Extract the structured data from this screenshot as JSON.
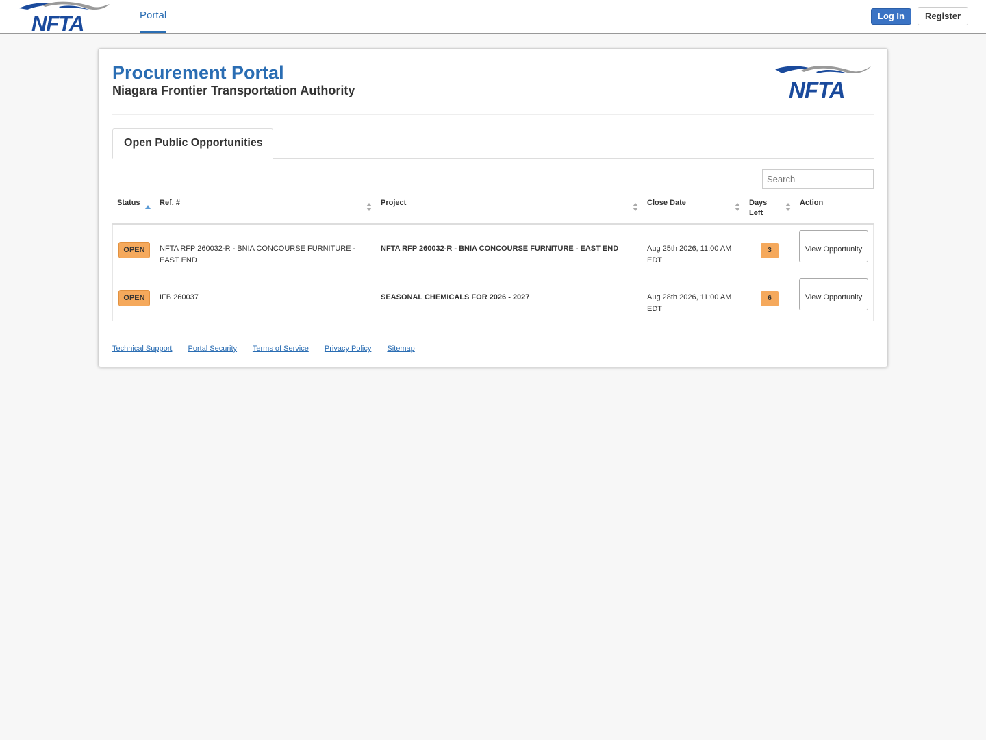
{
  "nav": {
    "portal_tab": "Portal",
    "login_label": "Log In",
    "register_label": "Register"
  },
  "logo": {
    "text": "NFTA",
    "icon": "nfta-logo"
  },
  "header": {
    "title": "Procurement Portal",
    "subtitle": "Niagara Frontier Transportation Authority"
  },
  "tabs": [
    {
      "label": "Open Public Opportunities",
      "active": true
    }
  ],
  "search": {
    "placeholder": "Search",
    "value": ""
  },
  "table": {
    "columns": [
      {
        "label": "Status",
        "sort": "asc"
      },
      {
        "label": "Ref. #",
        "sort": "none"
      },
      {
        "label": "Project",
        "sort": "none"
      },
      {
        "label": "Close Date",
        "sort": "none"
      },
      {
        "label": "Days Left",
        "sort": "none"
      },
      {
        "label": "Action",
        "sort": null
      }
    ],
    "rows": [
      {
        "status": "OPEN",
        "ref": "NFTA RFP 260032-R - BNIA CONCOURSE FURNITURE - EAST END",
        "project": "NFTA RFP 260032-R - BNIA CONCOURSE FURNITURE - EAST END",
        "close_date": "Aug 25th 2026, 11:00 AM EDT",
        "days_left": "3",
        "action": "View Opportunity"
      },
      {
        "status": "OPEN",
        "ref": "IFB 260037",
        "project": "SEASONAL CHEMICALS FOR 2026 - 2027",
        "close_date": "Aug 28th 2026, 11:00 AM EDT",
        "days_left": "6",
        "action": "View Opportunity"
      }
    ]
  },
  "footer": {
    "links": [
      "Technical Support",
      "Portal Security",
      "Terms of Service",
      "Privacy Policy",
      "Sitemap"
    ]
  },
  "colors": {
    "brand_blue": "#2a6db3",
    "logo_navy": "#1a4a9c",
    "badge_orange": "#f5a95c",
    "login_blue": "#3a73c4"
  }
}
